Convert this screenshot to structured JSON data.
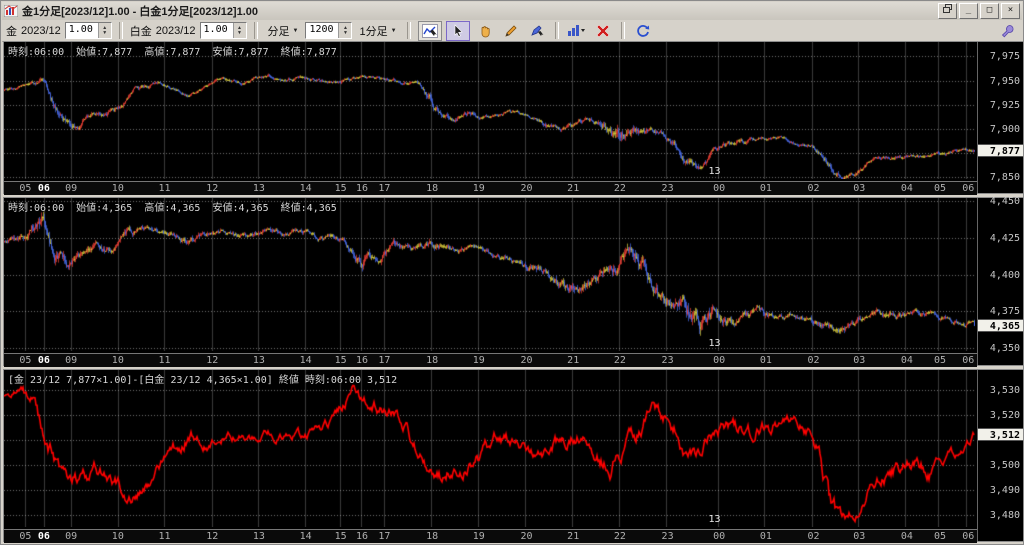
{
  "window": {
    "title": "金1分足[2023/12]1.00 - 白金1分足[2023/12]1.00",
    "buttons": [
      "float-window",
      "minimize",
      "maximize",
      "close"
    ],
    "button_glyphs": {
      "minimize": "_",
      "maximize": "□",
      "close": "×"
    }
  },
  "toolbar": {
    "gold_label": "金",
    "gold_month": "2023/12",
    "gold_multiplier": "1.00",
    "platinum_label": "白金",
    "platinum_month": "2023/12",
    "platinum_multiplier": "1.00",
    "period_dropdown": "分足",
    "bar_count": "1200",
    "interval_dropdown": "1分足",
    "icons": [
      "chart-cursor-icon",
      "pointer-icon",
      "hand-pan-icon",
      "pencil-icon",
      "pen-cursor-icon",
      "bar-chart-dropdown-icon",
      "delete-red-x-icon",
      "refresh-icon",
      "wrench-settings-icon"
    ]
  },
  "time_axis": {
    "highlight_index": 1,
    "date_marker": {
      "t": "13",
      "f": 0.724
    },
    "ticks": [
      {
        "t": "05",
        "f": 0.022
      },
      {
        "t": "06",
        "f": 0.041
      },
      {
        "t": "09",
        "f": 0.069
      },
      {
        "t": "10",
        "f": 0.117
      },
      {
        "t": "11",
        "f": 0.165
      },
      {
        "t": "12",
        "f": 0.214
      },
      {
        "t": "13",
        "f": 0.262
      },
      {
        "t": "14",
        "f": 0.31
      },
      {
        "t": "15",
        "f": 0.346
      },
      {
        "t": "16",
        "f": 0.368
      },
      {
        "t": "17",
        "f": 0.391
      },
      {
        "t": "18",
        "f": 0.44
      },
      {
        "t": "19",
        "f": 0.488
      },
      {
        "t": "20",
        "f": 0.537
      },
      {
        "t": "21",
        "f": 0.585
      },
      {
        "t": "22",
        "f": 0.633
      },
      {
        "t": "23",
        "f": 0.682
      },
      {
        "t": "00",
        "f": 0.735
      },
      {
        "t": "01",
        "f": 0.783
      },
      {
        "t": "02",
        "f": 0.832
      },
      {
        "t": "03",
        "f": 0.879
      },
      {
        "t": "04",
        "f": 0.928
      },
      {
        "t": "05",
        "f": 0.962
      },
      {
        "t": "06",
        "f": 0.991
      }
    ]
  },
  "charts": [
    {
      "header": "時刻:06:00  始値:7,877  高値:7,877  安値:7,877  終値:7,877",
      "last_price_label": "7,877",
      "date_marker": "13"
    },
    {
      "header": "時刻:06:00  始値:4,365  高値:4,365  安値:4,365  終値:4,365",
      "last_price_label": "4,365",
      "date_marker": "13"
    },
    {
      "header": "[金 23/12 7,877×1.00]-[白金 23/12 4,365×1.00] 終値 時刻:06:00 3,512",
      "last_price_label": "3,512",
      "date_marker": "13"
    }
  ],
  "chart_data": [
    {
      "type": "candlestick",
      "title": "金 1分足 2023/12",
      "bars": 1200,
      "ylim": [
        7848,
        7990
      ],
      "y_gridlines": [
        7975,
        7950,
        7925,
        7900,
        7875,
        7850
      ],
      "y_labels": [
        {
          "v": 7975,
          "t": "7,975"
        },
        {
          "v": 7950,
          "t": "7,950"
        },
        {
          "v": 7925,
          "t": "7,925"
        },
        {
          "v": 7900,
          "t": "7,900"
        },
        {
          "v": 7850,
          "t": "7,850"
        }
      ],
      "last": {
        "v": 7877,
        "t": "7,877"
      },
      "colors": {
        "up": "#e03c32",
        "down": "#4465dd",
        "flat": "#cfc43a"
      },
      "keypoints": [
        [
          0,
          7940,
          2
        ],
        [
          0.02,
          7946,
          2
        ],
        [
          0.042,
          7950,
          3
        ],
        [
          0.05,
          7928,
          5
        ],
        [
          0.062,
          7908,
          5
        ],
        [
          0.075,
          7898,
          4
        ],
        [
          0.09,
          7918,
          3
        ],
        [
          0.105,
          7912,
          3
        ],
        [
          0.12,
          7924,
          3
        ],
        [
          0.135,
          7940,
          3
        ],
        [
          0.155,
          7946,
          2
        ],
        [
          0.175,
          7942,
          2
        ],
        [
          0.19,
          7936,
          2
        ],
        [
          0.205,
          7944,
          2
        ],
        [
          0.225,
          7951,
          2
        ],
        [
          0.245,
          7949,
          2
        ],
        [
          0.265,
          7955,
          2
        ],
        [
          0.285,
          7951,
          2
        ],
        [
          0.305,
          7954,
          2
        ],
        [
          0.325,
          7951,
          2
        ],
        [
          0.345,
          7949,
          2
        ],
        [
          0.365,
          7952,
          2
        ],
        [
          0.385,
          7954,
          2
        ],
        [
          0.405,
          7950,
          2
        ],
        [
          0.425,
          7948,
          2
        ],
        [
          0.437,
          7932,
          5
        ],
        [
          0.45,
          7916,
          4
        ],
        [
          0.465,
          7911,
          3
        ],
        [
          0.48,
          7916,
          3
        ],
        [
          0.5,
          7914,
          2
        ],
        [
          0.52,
          7918,
          2
        ],
        [
          0.54,
          7912,
          2
        ],
        [
          0.56,
          7904,
          3
        ],
        [
          0.575,
          7898,
          3
        ],
        [
          0.59,
          7906,
          3
        ],
        [
          0.61,
          7908,
          3
        ],
        [
          0.625,
          7903,
          8
        ],
        [
          0.635,
          7890,
          9
        ],
        [
          0.648,
          7900,
          6
        ],
        [
          0.662,
          7895,
          4
        ],
        [
          0.676,
          7898,
          3
        ],
        [
          0.69,
          7886,
          4
        ],
        [
          0.702,
          7868,
          5
        ],
        [
          0.716,
          7861,
          4
        ],
        [
          0.73,
          7876,
          4
        ],
        [
          0.746,
          7882,
          3
        ],
        [
          0.762,
          7886,
          3
        ],
        [
          0.78,
          7889,
          2
        ],
        [
          0.8,
          7891,
          2
        ],
        [
          0.816,
          7886,
          2
        ],
        [
          0.832,
          7885,
          2
        ],
        [
          0.846,
          7868,
          4
        ],
        [
          0.858,
          7852,
          4
        ],
        [
          0.872,
          7851,
          3
        ],
        [
          0.886,
          7862,
          3
        ],
        [
          0.9,
          7868,
          2
        ],
        [
          0.92,
          7871,
          2
        ],
        [
          0.94,
          7873,
          2
        ],
        [
          0.96,
          7872,
          2
        ],
        [
          0.98,
          7875,
          2
        ],
        [
          1,
          7877,
          2
        ]
      ]
    },
    {
      "type": "candlestick",
      "title": "白金 1分足 2023/12",
      "bars": 1200,
      "ylim": [
        4348,
        4452
      ],
      "y_gridlines": [
        4450,
        4425,
        4400,
        4375,
        4350
      ],
      "y_labels": [
        {
          "v": 4450,
          "t": "4,450"
        },
        {
          "v": 4425,
          "t": "4,425"
        },
        {
          "v": 4400,
          "t": "4,400"
        },
        {
          "v": 4375,
          "t": "4,375"
        },
        {
          "v": 4350,
          "t": "4,350"
        }
      ],
      "last": {
        "v": 4365,
        "t": "4,365"
      },
      "colors": {
        "up": "#e03c32",
        "down": "#4465dd",
        "flat": "#cfc43a"
      },
      "keypoints": [
        [
          0,
          4422,
          2
        ],
        [
          0.02,
          4428,
          3
        ],
        [
          0.04,
          4441,
          6
        ],
        [
          0.052,
          4419,
          5
        ],
        [
          0.064,
          4408,
          4
        ],
        [
          0.078,
          4415,
          3
        ],
        [
          0.092,
          4421,
          3
        ],
        [
          0.11,
          4418,
          3
        ],
        [
          0.13,
          4428,
          3
        ],
        [
          0.15,
          4431,
          2
        ],
        [
          0.17,
          4428,
          2
        ],
        [
          0.19,
          4421,
          3
        ],
        [
          0.21,
          4427,
          2
        ],
        [
          0.23,
          4429,
          2
        ],
        [
          0.25,
          4426,
          2
        ],
        [
          0.27,
          4430,
          2
        ],
        [
          0.29,
          4427,
          2
        ],
        [
          0.31,
          4429,
          2
        ],
        [
          0.33,
          4425,
          2
        ],
        [
          0.35,
          4424,
          2
        ],
        [
          0.367,
          4407,
          5
        ],
        [
          0.382,
          4412,
          3
        ],
        [
          0.4,
          4418,
          3
        ],
        [
          0.42,
          4416,
          2
        ],
        [
          0.44,
          4421,
          3
        ],
        [
          0.46,
          4416,
          2
        ],
        [
          0.48,
          4418,
          2
        ],
        [
          0.5,
          4414,
          2
        ],
        [
          0.52,
          4410,
          2
        ],
        [
          0.54,
          4406,
          3
        ],
        [
          0.558,
          4401,
          3
        ],
        [
          0.575,
          4394,
          4
        ],
        [
          0.59,
          4390,
          4
        ],
        [
          0.605,
          4400,
          4
        ],
        [
          0.62,
          4406,
          4
        ],
        [
          0.635,
          4408,
          5
        ],
        [
          0.65,
          4413,
          6
        ],
        [
          0.662,
          4398,
          6
        ],
        [
          0.674,
          4385,
          5
        ],
        [
          0.688,
          4380,
          5
        ],
        [
          0.702,
          4372,
          7
        ],
        [
          0.716,
          4367,
          8
        ],
        [
          0.73,
          4373,
          5
        ],
        [
          0.746,
          4368,
          4
        ],
        [
          0.762,
          4371,
          3
        ],
        [
          0.78,
          4373,
          3
        ],
        [
          0.8,
          4370,
          2
        ],
        [
          0.82,
          4372,
          2
        ],
        [
          0.84,
          4368,
          3
        ],
        [
          0.856,
          4362,
          3
        ],
        [
          0.872,
          4368,
          3
        ],
        [
          0.89,
          4372,
          2
        ],
        [
          0.91,
          4375,
          3
        ],
        [
          0.93,
          4376,
          2
        ],
        [
          0.95,
          4374,
          2
        ],
        [
          0.97,
          4370,
          2
        ],
        [
          1,
          4365,
          2
        ]
      ]
    },
    {
      "type": "line",
      "title": "スプレッド (金-白金)",
      "color": "#ff0000",
      "ylim": [
        3475,
        3538
      ],
      "y_gridlines": [
        3530,
        3520,
        3510,
        3500,
        3490,
        3480
      ],
      "y_labels": [
        {
          "v": 3530,
          "t": "3,530"
        },
        {
          "v": 3520,
          "t": "3,520"
        },
        {
          "v": 3500,
          "t": "3,500"
        },
        {
          "v": 3490,
          "t": "3,490"
        },
        {
          "v": 3480,
          "t": "3,480"
        }
      ],
      "last": {
        "v": 3512,
        "t": "3,512"
      },
      "keypoints": [
        [
          0,
          3528,
          2
        ],
        [
          0.015,
          3531,
          2
        ],
        [
          0.03,
          3525,
          3
        ],
        [
          0.045,
          3506,
          4
        ],
        [
          0.06,
          3496,
          3
        ],
        [
          0.078,
          3494,
          3
        ],
        [
          0.095,
          3498,
          3
        ],
        [
          0.112,
          3495,
          3
        ],
        [
          0.13,
          3487,
          3
        ],
        [
          0.15,
          3493,
          2
        ],
        [
          0.17,
          3505,
          3
        ],
        [
          0.19,
          3512,
          3
        ],
        [
          0.21,
          3508,
          2
        ],
        [
          0.23,
          3512,
          2
        ],
        [
          0.25,
          3509,
          2
        ],
        [
          0.27,
          3512,
          2
        ],
        [
          0.29,
          3511,
          2
        ],
        [
          0.31,
          3512,
          2
        ],
        [
          0.33,
          3515,
          2
        ],
        [
          0.348,
          3521,
          3
        ],
        [
          0.36,
          3532,
          3
        ],
        [
          0.375,
          3526,
          3
        ],
        [
          0.39,
          3522,
          3
        ],
        [
          0.405,
          3518,
          3
        ],
        [
          0.42,
          3510,
          3
        ],
        [
          0.435,
          3501,
          3
        ],
        [
          0.45,
          3496,
          3
        ],
        [
          0.47,
          3498,
          3
        ],
        [
          0.49,
          3503,
          3
        ],
        [
          0.51,
          3512,
          3
        ],
        [
          0.53,
          3508,
          2
        ],
        [
          0.55,
          3504,
          3
        ],
        [
          0.57,
          3509,
          3
        ],
        [
          0.59,
          3512,
          3
        ],
        [
          0.61,
          3505,
          3
        ],
        [
          0.625,
          3498,
          4
        ],
        [
          0.64,
          3506,
          4
        ],
        [
          0.655,
          3513,
          3
        ],
        [
          0.67,
          3524,
          3
        ],
        [
          0.685,
          3518,
          3
        ],
        [
          0.7,
          3509,
          4
        ],
        [
          0.715,
          3505,
          3
        ],
        [
          0.73,
          3512,
          3
        ],
        [
          0.75,
          3516,
          3
        ],
        [
          0.77,
          3512,
          3
        ],
        [
          0.79,
          3515,
          3
        ],
        [
          0.81,
          3519,
          2
        ],
        [
          0.825,
          3515,
          3
        ],
        [
          0.84,
          3506,
          4
        ],
        [
          0.852,
          3483,
          4
        ],
        [
          0.866,
          3476,
          3
        ],
        [
          0.88,
          3483,
          3
        ],
        [
          0.9,
          3492,
          3
        ],
        [
          0.92,
          3498,
          3
        ],
        [
          0.94,
          3502,
          3
        ],
        [
          0.955,
          3497,
          3
        ],
        [
          0.97,
          3503,
          3
        ],
        [
          0.985,
          3506,
          2
        ],
        [
          1,
          3512,
          2
        ]
      ]
    }
  ]
}
